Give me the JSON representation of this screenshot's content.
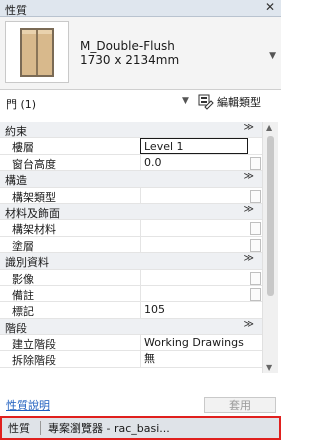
{
  "panel": {
    "title": "性質",
    "close_label": "✕"
  },
  "type_selector": {
    "family": "M_Double-Flush",
    "type": "1730 x 2134mm",
    "dropdown_icon": "chevron-down-icon"
  },
  "filter": {
    "category": "門 (1)",
    "edit_type_label": "編輯類型",
    "dropdown_icon": "chevron-down-icon"
  },
  "groups": [
    {
      "label": "約束",
      "collapse_glyph": "≫",
      "properties": [
        {
          "name": "樓層",
          "value": "Level 1",
          "editing": true
        },
        {
          "name": "窗台高度",
          "value": "0.0"
        }
      ]
    },
    {
      "label": "構造",
      "collapse_glyph": "≫",
      "properties": [
        {
          "name": "構架類型",
          "value": ""
        }
      ]
    },
    {
      "label": "材料及飾面",
      "collapse_glyph": "≫",
      "properties": [
        {
          "name": "構架材料",
          "value": ""
        },
        {
          "name": "塗層",
          "value": ""
        }
      ]
    },
    {
      "label": "識別資料",
      "collapse_glyph": "≫",
      "properties": [
        {
          "name": "影像",
          "value": ""
        },
        {
          "name": "備註",
          "value": ""
        },
        {
          "name": "標記",
          "value": "105"
        }
      ]
    },
    {
      "label": "階段",
      "collapse_glyph": "≫",
      "properties": [
        {
          "name": "建立階段",
          "value": "Working Drawings"
        },
        {
          "name": "拆除階段",
          "value": "無"
        }
      ]
    }
  ],
  "footer": {
    "help_link": "性質說明",
    "apply_button": "套用"
  },
  "bottom_tabs": [
    "性質",
    "專案瀏覽器 - rac_basi..."
  ],
  "colors": {
    "highlight_border": "#e0201e",
    "link": "#1f5fbf",
    "titlebar": "#dfe6ee"
  }
}
